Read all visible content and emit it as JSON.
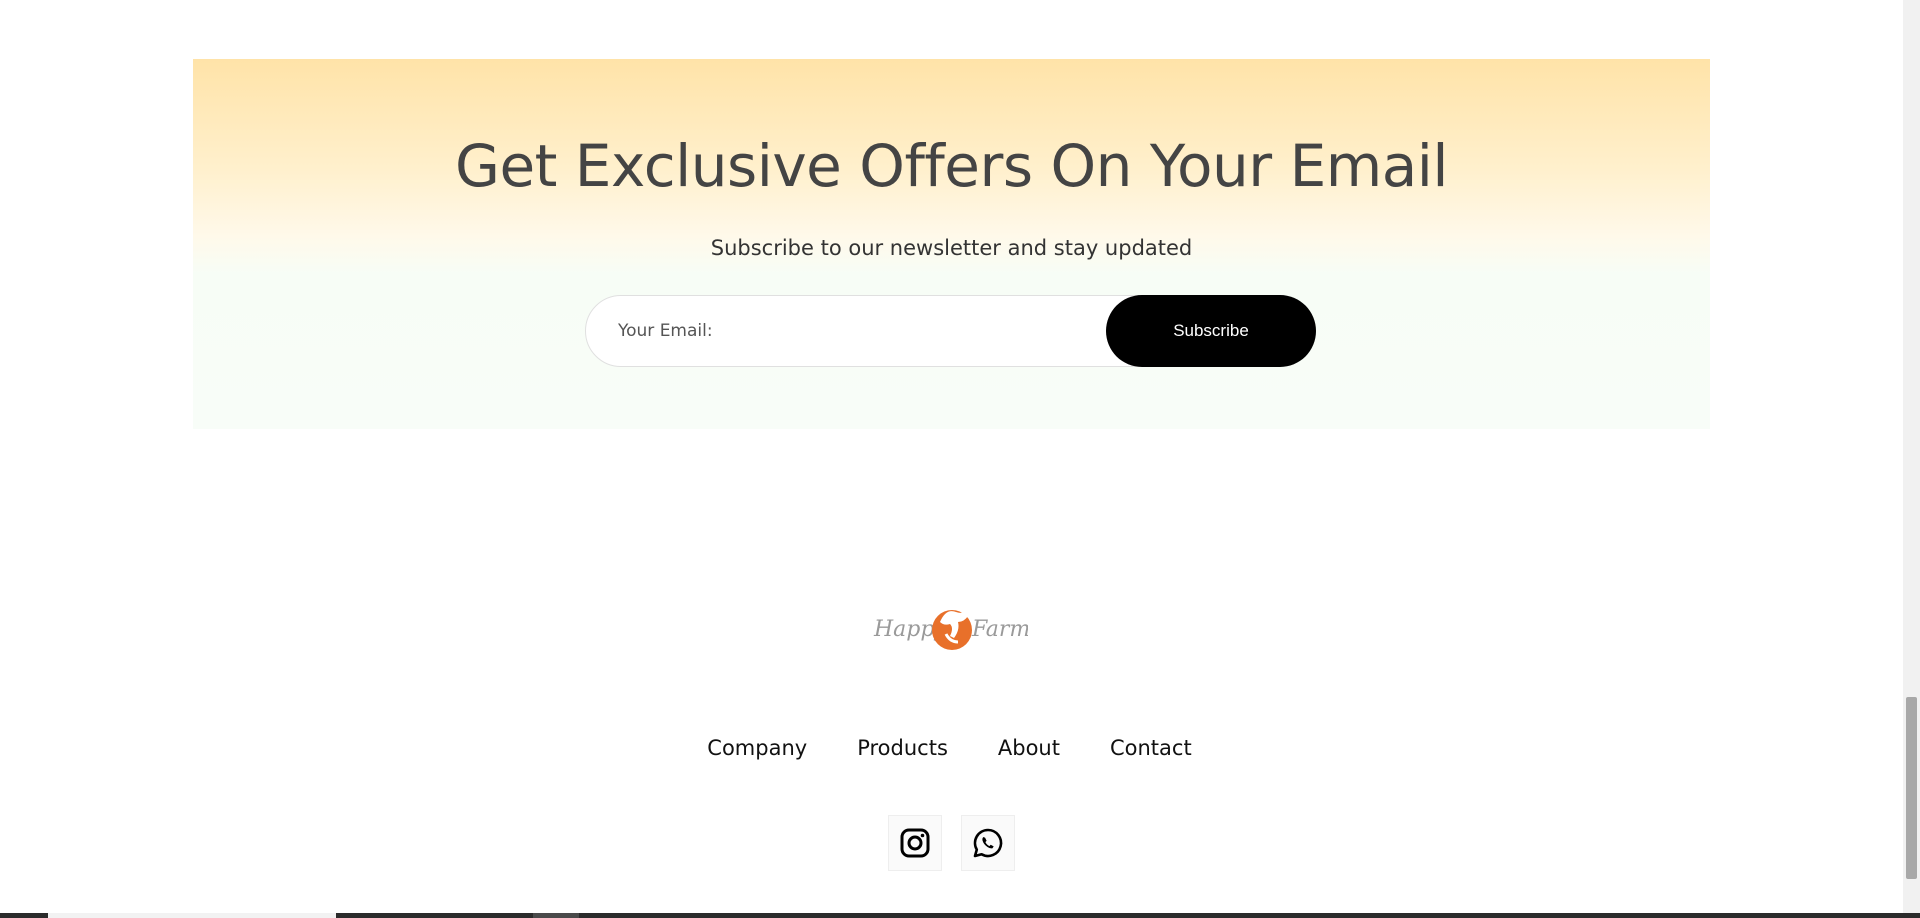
{
  "newsletter": {
    "title": "Get Exclusive Offers On Your Email",
    "subtitle": "Subscribe to our newsletter and stay updated",
    "email_placeholder": "Your Email:",
    "email_value": "",
    "subscribe_label": "Subscribe"
  },
  "footer": {
    "logo_text": "Happy Farm",
    "nav": [
      {
        "label": "Company"
      },
      {
        "label": "Products"
      },
      {
        "label": "About"
      },
      {
        "label": "Contact"
      }
    ],
    "social": [
      {
        "icon": "instagram-icon"
      },
      {
        "icon": "whatsapp-icon"
      }
    ]
  },
  "colors": {
    "banner_top": "#ffe3a8",
    "banner_bottom": "#f8fdf8",
    "button_bg": "#000000",
    "logo_orange": "#e8702a"
  }
}
